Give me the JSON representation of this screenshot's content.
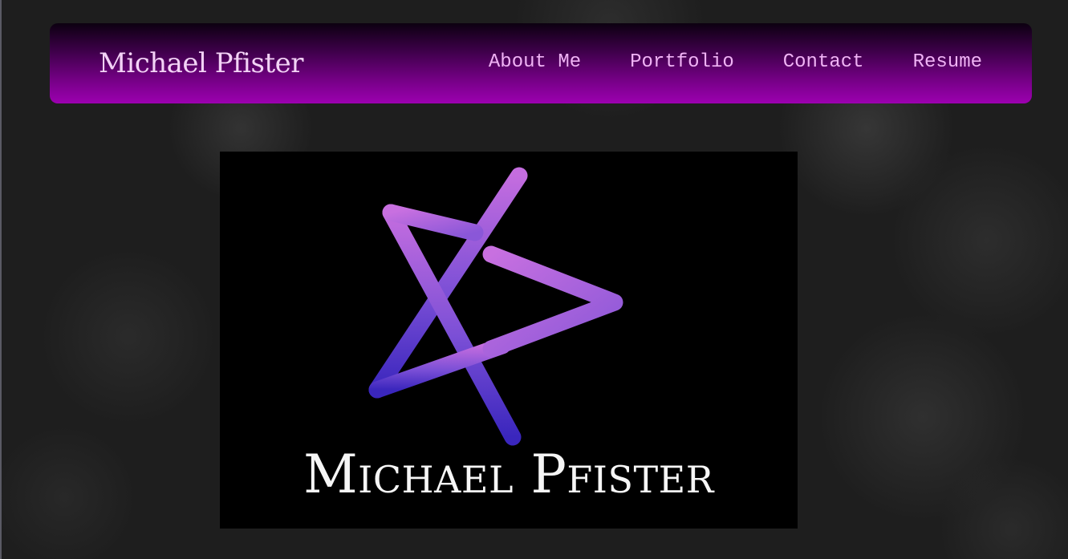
{
  "header": {
    "brand": "Michael Pfister",
    "nav": [
      {
        "label": "About Me"
      },
      {
        "label": "Portfolio"
      },
      {
        "label": "Contact"
      },
      {
        "label": "Resume"
      }
    ]
  },
  "hero": {
    "logo_text": "Michael Pfister",
    "logo_icon": "star-monogram-icon"
  },
  "colors": {
    "nav_gradient_top": "#0c0010",
    "nav_gradient_bottom": "#9c00b0",
    "nav_link": "#f0b3f5",
    "brand_text": "#f3d3f6",
    "logo_purple_light": "#c06ee0",
    "logo_purple_dark": "#3d25c0",
    "page_background": "#1e1e1e"
  }
}
